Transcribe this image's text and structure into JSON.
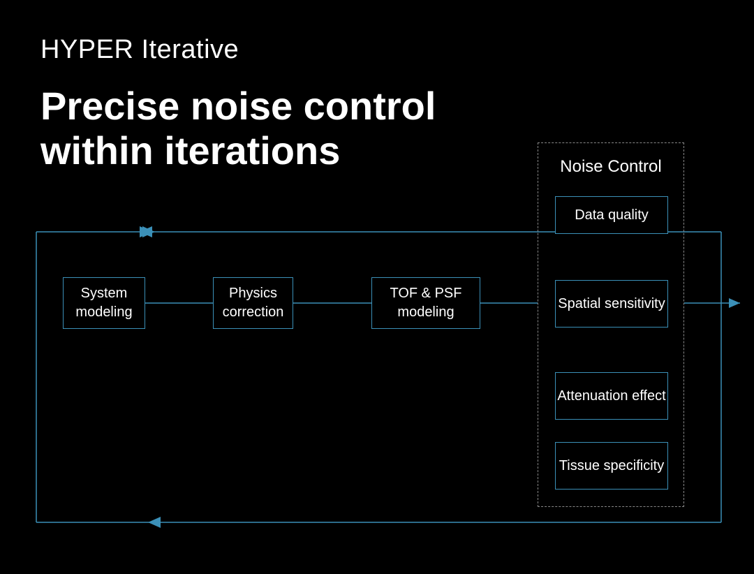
{
  "header": {
    "subtitle": "HYPER Iterative",
    "headline_line1": "Precise noise control",
    "headline_line2": "within iterations"
  },
  "pipeline": {
    "step1": "System modeling",
    "step2": "Physics correction",
    "step3": "TOF & PSF modeling"
  },
  "noise_control": {
    "title": "Noise Control",
    "items": [
      "Data quality",
      "Spatial sensitivity",
      "Attenuation effect",
      "Tissue specificity"
    ]
  },
  "colors": {
    "line": "#3b90b8",
    "bg": "#000000",
    "text": "#ffffff"
  }
}
